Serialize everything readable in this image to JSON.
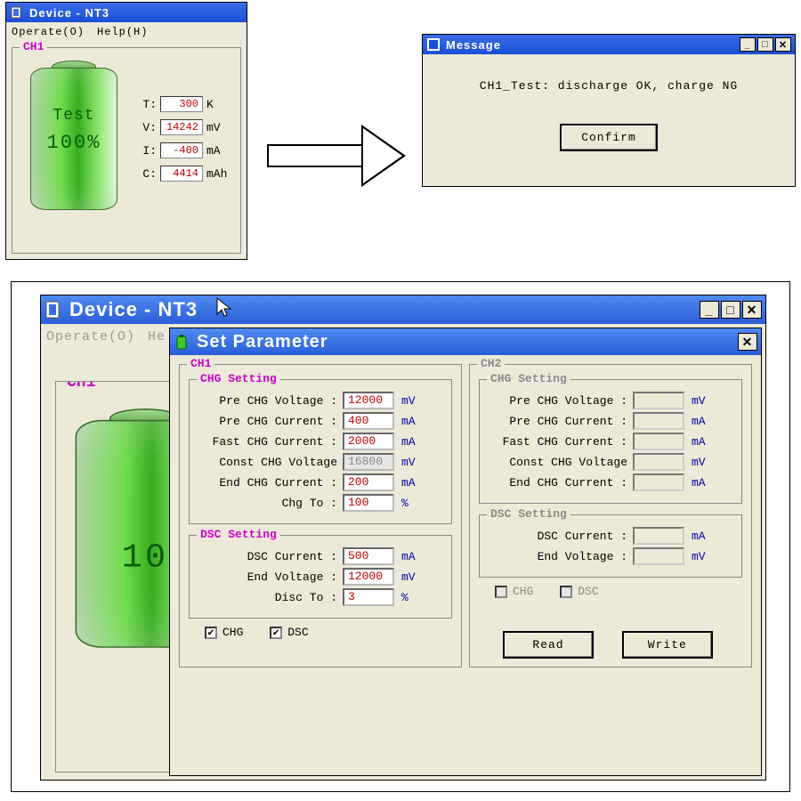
{
  "top_window": {
    "title": "Device - NT3",
    "menu": {
      "operate": "Operate(O)",
      "help": "Help(H)"
    },
    "channel_label": "CH1",
    "battery": {
      "label": "Test",
      "percent": "100%"
    },
    "readouts": {
      "t_key": "T:",
      "t_val": "300",
      "t_unit": "K",
      "v_key": "V:",
      "v_val": "14242",
      "v_unit": "mV",
      "i_key": "I:",
      "i_val": "-400",
      "i_unit": "mA",
      "c_key": "C:",
      "c_val": "4414",
      "c_unit": "mAh"
    }
  },
  "message": {
    "title": "Message",
    "text": "CH1_Test: discharge OK, charge NG",
    "confirm": "Confirm"
  },
  "lower": {
    "device_title": "Device - NT3",
    "menu": {
      "operate": "Operate(O)",
      "help_prefix": "He"
    },
    "channel_label": "CH1",
    "battery_percent": "10",
    "set_param_title": "Set Parameter",
    "ch1": {
      "label": "CH1",
      "chg_label": "CHG Setting",
      "pre_v_label": "Pre CHG Voltage :",
      "pre_v_val": "12000",
      "pre_v_unit": "mV",
      "pre_i_label": "Pre CHG Current :",
      "pre_i_val": "400",
      "pre_i_unit": "mA",
      "fast_i_label": "Fast CHG Current :",
      "fast_i_val": "2000",
      "fast_i_unit": "mA",
      "const_v_label": "Const CHG Voltage",
      "const_v_val": "16800",
      "const_v_unit": "mV",
      "end_i_label": "End CHG Current :",
      "end_i_val": "200",
      "end_i_unit": "mA",
      "chg_to_label": "Chg To :",
      "chg_to_val": "100",
      "chg_to_unit": "%",
      "dsc_label": "DSC Setting",
      "dsc_i_label": "DSC Current :",
      "dsc_i_val": "500",
      "dsc_i_unit": "mA",
      "end_v_label": "End Voltage :",
      "end_v_val": "12000",
      "end_v_unit": "mV",
      "disc_to_label": "Disc To :",
      "disc_to_val": "3",
      "disc_to_unit": "%",
      "chk_chg": "CHG",
      "chk_dsc": "DSC"
    },
    "ch2": {
      "label": "CH2",
      "chg_label": "CHG Setting",
      "pre_v_label": "Pre CHG Voltage :",
      "pre_v_unit": "mV",
      "pre_i_label": "Pre CHG Current :",
      "pre_i_unit": "mA",
      "fast_i_label": "Fast CHG Current :",
      "fast_i_unit": "mA",
      "const_v_label": "Const CHG Voltage",
      "const_v_unit": "mV",
      "end_i_label": "End CHG Current :",
      "end_i_unit": "mA",
      "dsc_label": "DSC Setting",
      "dsc_i_label": "DSC Current :",
      "dsc_i_unit": "mA",
      "end_v_label": "End Voltage :",
      "end_v_unit": "mV",
      "chk_chg": "CHG",
      "chk_dsc": "DSC"
    },
    "read_btn": "Read",
    "write_btn": "Write"
  }
}
